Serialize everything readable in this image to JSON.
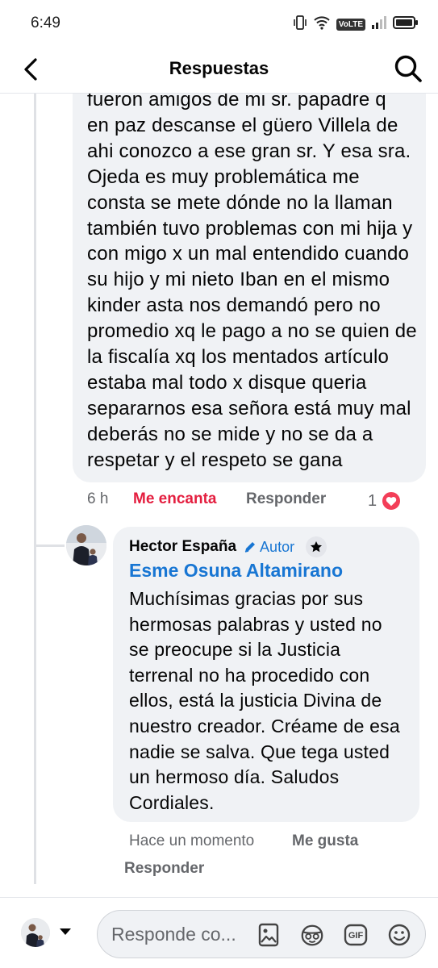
{
  "status_bar": {
    "time": "6:49",
    "network_label": "VoLTE"
  },
  "header": {
    "title": "Respuestas",
    "back_icon": "chevron-left-icon",
    "search_icon": "search-icon"
  },
  "comment": {
    "text": "fueron  amigos  de mi sr. papadre  q\nen paz descanse el güero Villela de\nahi conozco a ese gran sr. Y esa sra.\nOjeda es muy problemática me\nconsta se mete dónde no la llaman\ntambién tuvo problemas con mi hija y\ncon migo x un mal entendido cuando\nsu hijo y mi nieto Iban en el mismo\nkinder asta nos demandó pero no\npromedio xq le pago a no se quien de\nla fiscalía xq los mentados artículo\nestaba mal todo x disque queria\nsepararnos esa señora está muy mal\ndeberás no se mide y no se da a\nrespetar y el respeto se gana",
    "time": "6 h",
    "reaction_label": "Me encanta",
    "reply_label": "Responder",
    "reaction_count": "1",
    "reaction_icon": "heart-icon"
  },
  "reply": {
    "author": "Hector España",
    "author_badge": "Autor",
    "mention": "Esme Osuna Altamirano",
    "text": "Muchísimas gracias por sus\nhermosas palabras y usted no\nse preocupe si la Justicia\nterrenal no ha procedido con\nellos, está la justicia Divina de\nnuestro creador. Créame de esa\nnadie se salva. Que tega usted\nun hermoso día. Saludos\nCordiales.",
    "time": "Hace un momento",
    "like_label": "Me gusta",
    "reply_label": "Responder"
  },
  "composer": {
    "placeholder": "Responde co...",
    "gif_label": "GIF"
  },
  "colors": {
    "accent_blue": "#1876d3",
    "love_red": "#e41e3f",
    "bubble_bg": "#f0f2f5",
    "meta_gray": "#65676b"
  }
}
